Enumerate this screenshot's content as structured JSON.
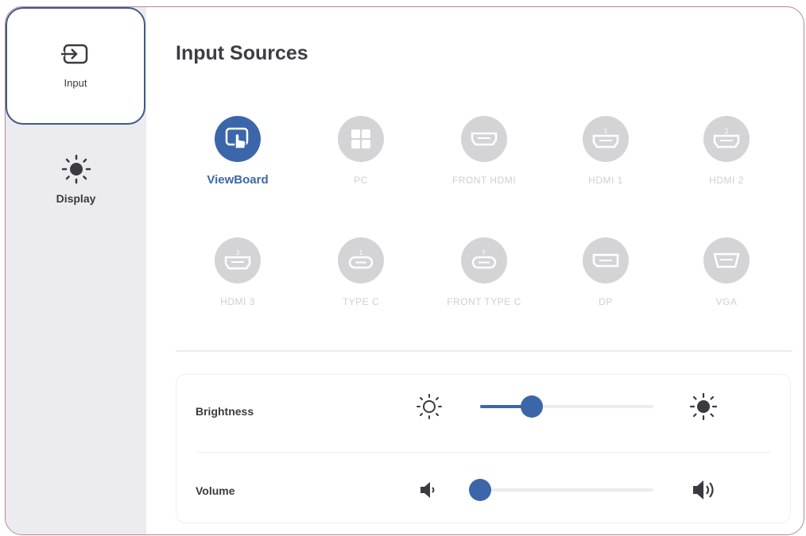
{
  "sidebar": {
    "items": [
      {
        "label": "Input",
        "icon": "input-icon",
        "selected": true
      },
      {
        "label": "Display",
        "icon": "sun-icon",
        "selected": false
      }
    ]
  },
  "main": {
    "title": "Input Sources",
    "sources": [
      {
        "label": "ViewBoard",
        "icon": "viewboard-icon",
        "active": true
      },
      {
        "label": "PC",
        "icon": "windows-icon",
        "active": false
      },
      {
        "label": "FRONT HDMI",
        "icon": "hdmi-icon",
        "active": false
      },
      {
        "label": "HDMI 1",
        "icon": "hdmi-icon",
        "active": false
      },
      {
        "label": "HDMI 2",
        "icon": "hdmi-icon",
        "active": false
      },
      {
        "label": "HDMI 3",
        "icon": "hdmi-icon",
        "active": false
      },
      {
        "label": "TYPE C",
        "icon": "usb-c-icon",
        "active": false
      },
      {
        "label": "FRONT TYPE C",
        "icon": "usb-c-icon",
        "active": false
      },
      {
        "label": "DP",
        "icon": "displayport-icon",
        "active": false
      },
      {
        "label": "VGA",
        "icon": "vga-icon",
        "active": false
      }
    ],
    "brightness": {
      "label": "Brightness",
      "level": 0.3
    },
    "volume": {
      "label": "Volume",
      "level": 0.0
    }
  },
  "colors": {
    "accent": "#3c66aa",
    "inactive": "#d4d4d6",
    "sidebar_bg": "#ecebf0"
  }
}
